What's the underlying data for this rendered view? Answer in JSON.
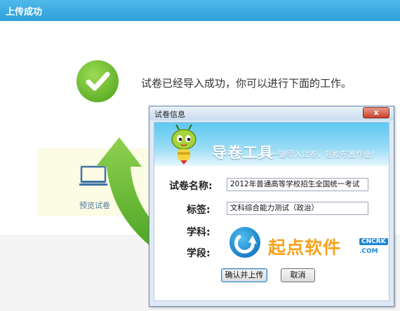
{
  "header": {
    "title": "上传成功"
  },
  "success": {
    "message": "试卷已经导入成功，你可以进行下面的工作。",
    "icon": "checkmark-icon"
  },
  "preview": {
    "label": "预览试卷",
    "icon": "monitor-icon"
  },
  "dialog": {
    "title": "试卷信息",
    "close_label": "x",
    "banner": {
      "title": "导卷工具",
      "subtitle": "一键导入试卷，轻松布置作业！"
    },
    "fields": [
      {
        "label": "试卷名称:",
        "value": "2012年普通高等学校招生全国统一考试"
      },
      {
        "label": "标签:",
        "value": "文科综合能力测试（政治）"
      },
      {
        "label": "学科:",
        "value": ""
      },
      {
        "label": "学段:",
        "value": ""
      }
    ],
    "buttons": {
      "confirm": "确认并上传",
      "cancel": "取消"
    }
  },
  "watermark": {
    "text": "起点软件",
    "tag": "CNCRK",
    "domain": ".COM"
  },
  "colors": {
    "header": "#35a6dd",
    "success_green": "#62b22a",
    "arrow_green": "#5cb82a",
    "dialog_border": "#6a8db5"
  }
}
